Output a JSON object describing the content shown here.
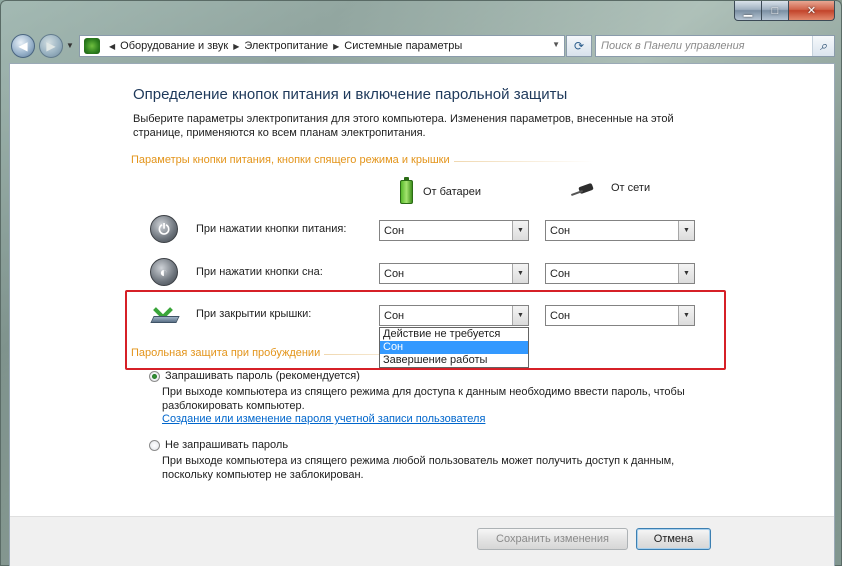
{
  "window": {
    "caption": {
      "minimize": "▁",
      "maximize": "□",
      "close": "✕"
    }
  },
  "address_bar": {
    "icon": "control-panel-icon",
    "crumbs": [
      "Оборудование и звук",
      "Электропитание",
      "Системные параметры"
    ],
    "search_placeholder": "Поиск в Панели управления"
  },
  "page": {
    "title": "Определение кнопок питания и включение парольной защиты",
    "intro": "Выберите параметры электропитания для этого компьютера. Изменения параметров, внесенные на этой странице, применяются ко всем планам электропитания."
  },
  "buttons_section": {
    "header": "Параметры кнопки питания, кнопки спящего режима и крышки",
    "col_battery": "От батареи",
    "col_ac": "От сети",
    "rows": [
      {
        "icon": "power-button-icon",
        "label": "При нажатии кнопки питания:",
        "battery": "Сон",
        "ac": "Сон"
      },
      {
        "icon": "sleep-button-icon",
        "label": "При нажатии кнопки сна:",
        "battery": "Сон",
        "ac": "Сон"
      },
      {
        "icon": "laptop-lid-icon",
        "label": "При закрытии крышки:",
        "battery": "Сон",
        "ac": "Сон"
      }
    ],
    "dropdown_options": [
      "Действие не требуется",
      "Сон",
      "Завершение работы"
    ],
    "dropdown_selected_index": 1
  },
  "password_section": {
    "header": "Парольная защита при пробуждении",
    "options": [
      {
        "label": "Запрашивать пароль (рекомендуется)",
        "description": "При выходе компьютера из спящего режима для доступа к данным необходимо ввести пароль, чтобы разблокировать компьютер.",
        "link": "Создание или изменение пароля учетной записи пользователя",
        "checked": true
      },
      {
        "label": "Не запрашивать пароль",
        "description": "При выходе компьютера из спящего режима любой пользователь может получить доступ к данным, поскольку компьютер не заблокирован.",
        "checked": false
      }
    ]
  },
  "footer": {
    "save": "Сохранить изменения",
    "cancel": "Отмена"
  },
  "colors": {
    "title": "#1e395b",
    "section_header": "#e3941a",
    "link": "#0066cc",
    "highlight": "#d62027",
    "selection": "#3399ff"
  }
}
